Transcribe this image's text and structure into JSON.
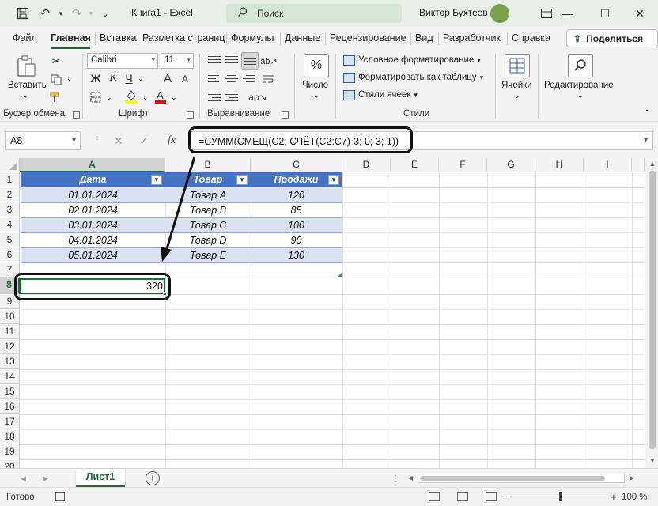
{
  "titlebar": {
    "doc_title": "Книга1  -  Excel",
    "search_label": "Поиск",
    "user_name": "Виктор Бухтеев",
    "icons": [
      "save-icon",
      "undo-icon",
      "redo-icon",
      "customize-icon",
      "minimize-icon",
      "maximize-icon",
      "close-icon"
    ]
  },
  "menu": {
    "tabs": [
      "Файл",
      "Главная",
      "Вставка",
      "Разметка страниц",
      "Формулы",
      "Данные",
      "Рецензирование",
      "Вид",
      "Разработчик",
      "Справка"
    ],
    "active": "Главная",
    "share_label": "Поделиться"
  },
  "ribbon": {
    "clipboard": {
      "paste_label": "Вставить",
      "group_label": "Буфер обмена"
    },
    "font": {
      "name": "Calibri",
      "size": "11",
      "bold": "Ж",
      "italic": "К",
      "underline": "Ч",
      "grow": "A",
      "shrink": "A",
      "group_label": "Шрифт",
      "fill_color": "#ffff00",
      "font_color": "#ff0000"
    },
    "alignment": {
      "group_label": "Выравнивание"
    },
    "number": {
      "label": "Число",
      "glyph": "%"
    },
    "styles": {
      "conditional": "Условное форматирование",
      "as_table": "Форматировать как таблицу",
      "cell_styles": "Стили ячеек",
      "group_label": "Стили"
    },
    "cells": {
      "label": "Ячейки"
    },
    "editing": {
      "label": "Редактирование"
    }
  },
  "formula_bar": {
    "name_box": "A8",
    "cancel": "✕",
    "enter": "✓",
    "fx": "fx",
    "formula": "=СУММ(СМЕЩ(C2; СЧЁТ(C2:C7)-3; 0; 3; 1))"
  },
  "grid": {
    "columns": [
      "A",
      "B",
      "C",
      "D",
      "E",
      "F",
      "G",
      "H",
      "I"
    ],
    "rows": [
      "1",
      "2",
      "3",
      "4",
      "5",
      "6",
      "7",
      "8",
      "9",
      "10",
      "11",
      "12",
      "13",
      "14",
      "15",
      "16",
      "17",
      "18",
      "19",
      "20"
    ],
    "selected_col": "A",
    "selected_row": "8",
    "table_headers": [
      "Дата",
      "Товар",
      "Продажи"
    ],
    "table_rows": [
      [
        "01.01.2024",
        "Товар A",
        "120"
      ],
      [
        "02.01.2024",
        "Товар B",
        "85"
      ],
      [
        "03.01.2024",
        "Товар C",
        "100"
      ],
      [
        "04.01.2024",
        "Товар D",
        "90"
      ],
      [
        "05.01.2024",
        "Товар E",
        "130"
      ]
    ],
    "result_cell": "320",
    "header_color": "#4472c4",
    "band_color": "#d9e1f2",
    "accent": "#1d6b3c"
  },
  "sheets": {
    "tabs": [
      "Лист1"
    ],
    "add": "+"
  },
  "status": {
    "ready": "Готово",
    "zoom": "100 %"
  }
}
